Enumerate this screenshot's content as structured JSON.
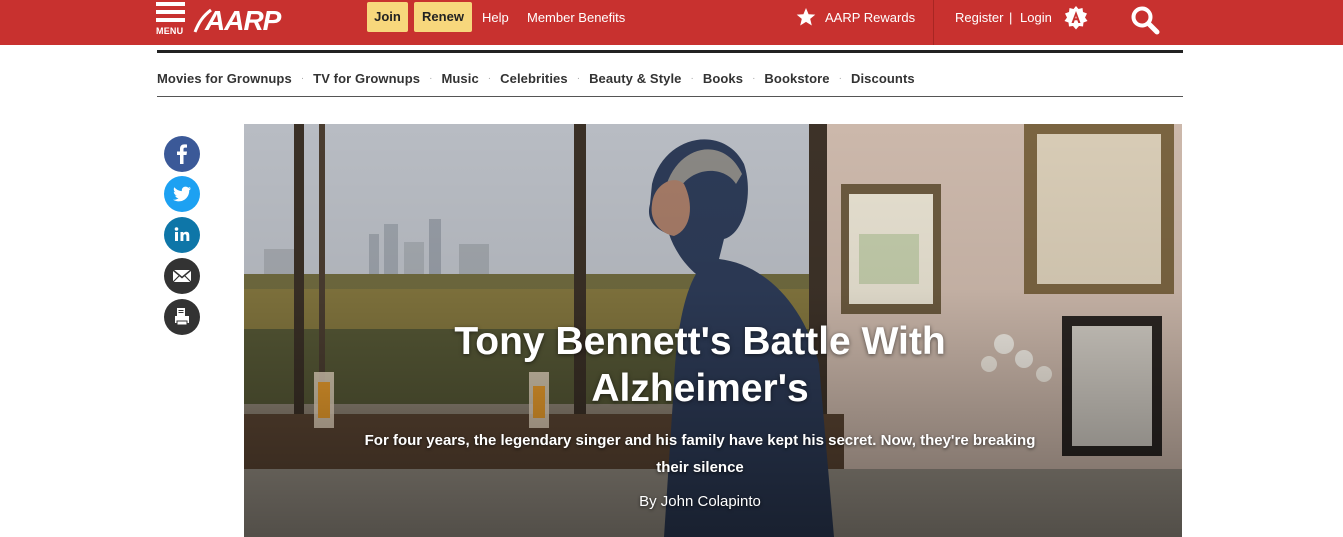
{
  "header": {
    "menu_label": "MENU",
    "logo_text": "AARP",
    "join_label": "Join",
    "renew_label": "Renew",
    "help_label": "Help",
    "member_benefits_label": "Member Benefits",
    "rewards_label": "AARP Rewards",
    "register_label": "Register",
    "register_sep": "|",
    "login_label": "Login",
    "brand_color": "#c8312f",
    "pill_color": "#f7d77c",
    "icons": [
      "menu-icon",
      "star-icon",
      "login-icon",
      "search-icon"
    ]
  },
  "subnav": {
    "items": [
      {
        "label": "Movies for Grownups"
      },
      {
        "label": "TV for Grownups"
      },
      {
        "label": "Music"
      },
      {
        "label": "Celebrities"
      },
      {
        "label": "Beauty & Style"
      },
      {
        "label": "Books"
      },
      {
        "label": "Bookstore"
      },
      {
        "label": "Discounts"
      }
    ],
    "separator": "·"
  },
  "share": {
    "items": [
      {
        "name": "facebook",
        "color": "#3b5998",
        "icon": "facebook-icon"
      },
      {
        "name": "twitter",
        "color": "#1da1f2",
        "icon": "twitter-icon"
      },
      {
        "name": "linkedin",
        "color": "#0e76a8",
        "icon": "linkedin-icon"
      },
      {
        "name": "email",
        "color": "#333333",
        "icon": "email-icon"
      },
      {
        "name": "print",
        "color": "#333333",
        "icon": "print-icon"
      }
    ]
  },
  "hero": {
    "title": "Tony Bennett's Battle With Alzheimer's",
    "dek": "For four years, the legendary singer and his family have kept his secret. Now, they're breaking their silence",
    "byline": "By John Colapinto"
  }
}
